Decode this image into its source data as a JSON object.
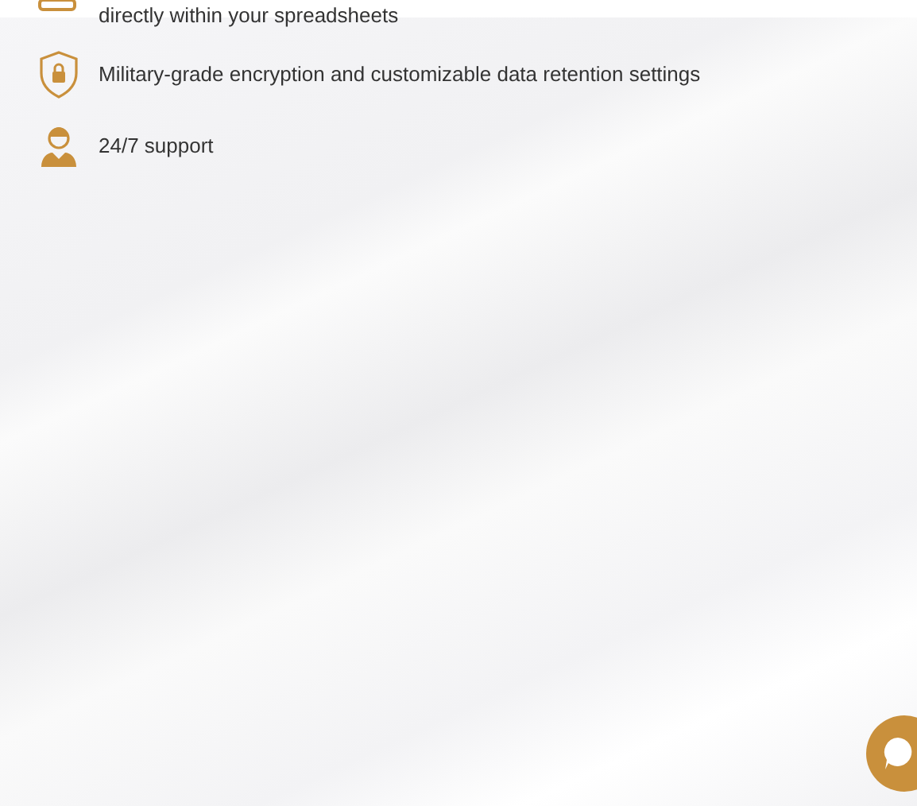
{
  "features": [
    {
      "kind": "sheet",
      "text": "directly within your spreadsheets"
    },
    {
      "kind": "shield",
      "text": "Military-grade encryption and customizable data retention settings"
    },
    {
      "kind": "agent",
      "text": "24/7 support"
    }
  ]
}
